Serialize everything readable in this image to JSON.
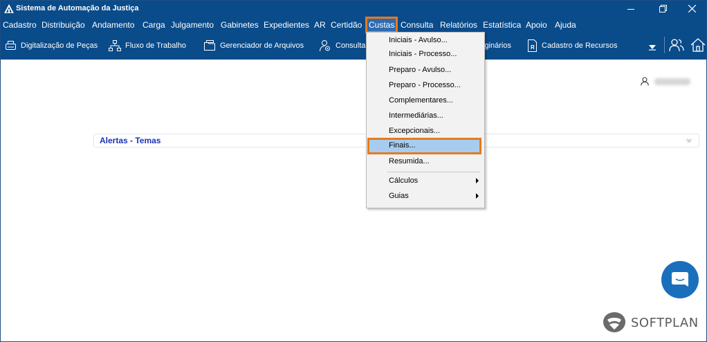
{
  "window": {
    "title": "Sistema de Automação da Justiça"
  },
  "menubar": {
    "items": [
      {
        "label": "Cadastro"
      },
      {
        "label": "Distribuição"
      },
      {
        "label": "Andamento"
      },
      {
        "label": "Carga"
      },
      {
        "label": "Julgamento"
      },
      {
        "label": "Gabinetes"
      },
      {
        "label": "Expedientes"
      },
      {
        "label": "AR"
      },
      {
        "label": "Certidão"
      },
      {
        "label": "Custas"
      },
      {
        "label": "Consulta"
      },
      {
        "label": "Relatórios"
      },
      {
        "label": "Estatística"
      },
      {
        "label": "Apoio"
      },
      {
        "label": "Ajuda"
      }
    ],
    "active": "Custas"
  },
  "toolbar": {
    "items": [
      {
        "label": "Digitalização de Peças",
        "icon": "scanner-icon"
      },
      {
        "label": "Fluxo de Trabalho",
        "icon": "workflow-icon"
      },
      {
        "label": "Gerenciador de Arquivos",
        "icon": "folder-icon"
      },
      {
        "label": "Consulta",
        "icon": "user-search-icon"
      },
      {
        "label": "iginários",
        "icon": ""
      },
      {
        "label": "Cadastro de Recursos",
        "icon": "document-r-icon"
      }
    ]
  },
  "main": {
    "alerts_label": "Alertas - Temas"
  },
  "custas_menu": {
    "items": [
      {
        "label": "Iniciais - Avulso...",
        "mnemonic": "I"
      },
      {
        "label": "Iniciais - Processo...",
        "mnemonic": "n"
      },
      {
        "label": "Preparo - Avulso...",
        "mnemonic": "P"
      },
      {
        "label": "Preparo - Processo...",
        "mnemonic": "r"
      },
      {
        "label": "Complementares...",
        "mnemonic": "C"
      },
      {
        "label": "Intermediárias...",
        "mnemonic": "t"
      },
      {
        "label": "Excepcionais...",
        "mnemonic": "x"
      },
      {
        "label": "Finais...",
        "mnemonic": "F",
        "highlighted": true
      },
      {
        "label": "Resumida...",
        "mnemonic": "e"
      },
      {
        "label": "Cálculos",
        "submenu": true
      },
      {
        "label": "Guias",
        "submenu": true
      }
    ]
  },
  "branding": {
    "logo_text": "SOFTPLAN"
  },
  "colors": {
    "header_bg": "#0a4b8a",
    "highlight_border": "#e8791c",
    "highlight_bg": "#a6cdf0",
    "alerts_text": "#1a34b8",
    "chat_button": "#1a6fbd"
  }
}
